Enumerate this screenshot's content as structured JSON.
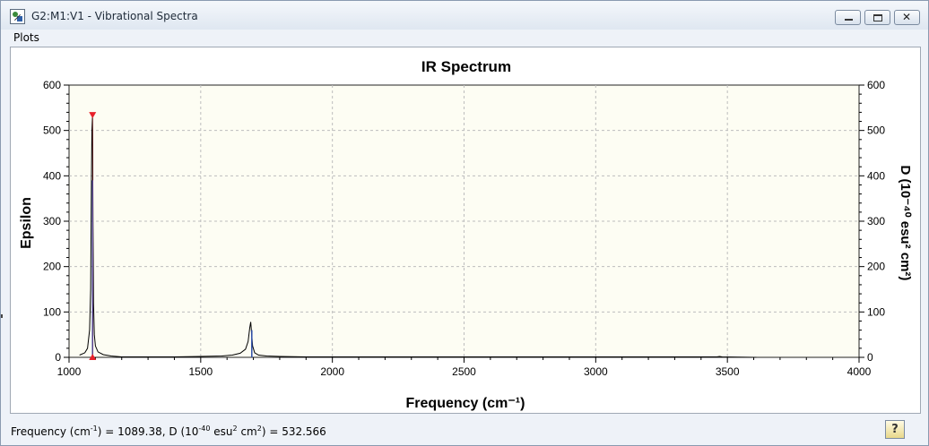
{
  "window": {
    "title": "G2:M1:V1 - Vibrational Spectra",
    "icon": "spectrum-app-icon",
    "controls": {
      "minimize": "minimize-icon",
      "restore": "restore-icon",
      "close": "close-icon"
    }
  },
  "menu": {
    "plots_label": "Plots"
  },
  "status": {
    "freq_prefix": "Frequency (cm",
    "freq_exp": "-1",
    "freq_mid": ") = 1089.38, D (10",
    "d_exp": "-40",
    "d_unit_a": " esu",
    "d_unit_exp1": "2",
    "d_unit_b": " cm",
    "d_unit_exp2": "2",
    "d_value": ") = 532.566",
    "help_label": "?"
  },
  "chart_data": {
    "type": "line",
    "title": "IR Spectrum",
    "xlabel": "Frequency (cm⁻¹)",
    "ylabel": "Epsilon",
    "ylabel_right": "D (10⁻⁴⁰ esu² cm²)",
    "xlim": [
      1000,
      4000
    ],
    "ylim": [
      0,
      600
    ],
    "ylim_right": [
      0,
      600
    ],
    "xticks": [
      1000,
      1500,
      2000,
      2500,
      3000,
      3500,
      4000
    ],
    "yticks": [
      0,
      100,
      200,
      300,
      400,
      500,
      600
    ],
    "grid": true,
    "background_color": "#fdfdf3",
    "series": [
      {
        "color": "#000000",
        "x": [
          1040,
          1060,
          1070,
          1078,
          1082,
          1085,
          1087,
          1089.38,
          1091,
          1093,
          1096,
          1100,
          1110,
          1130,
          1160,
          1200,
          1300,
          1400,
          1500,
          1580,
          1620,
          1650,
          1670,
          1680,
          1686,
          1690,
          1693,
          1697,
          1705,
          1720,
          1750,
          1800,
          1900,
          2100,
          2500,
          3000,
          3460,
          3470,
          3480,
          3600,
          3610
        ],
        "y": [
          5,
          10,
          20,
          60,
          150,
          400,
          500,
          532,
          300,
          120,
          50,
          25,
          12,
          6,
          3,
          1,
          1,
          1,
          2,
          3,
          5,
          9,
          18,
          35,
          65,
          78,
          55,
          25,
          10,
          5,
          3,
          2,
          1,
          1,
          1,
          1,
          1,
          2,
          1,
          0,
          0
        ]
      }
    ],
    "sticks": {
      "color": "#2e4ea8",
      "x": [
        1089.38,
        1694
      ],
      "y": [
        390,
        60
      ]
    },
    "marker": {
      "x": 1089.38,
      "y": 532.566,
      "color": "#e8202a"
    }
  }
}
